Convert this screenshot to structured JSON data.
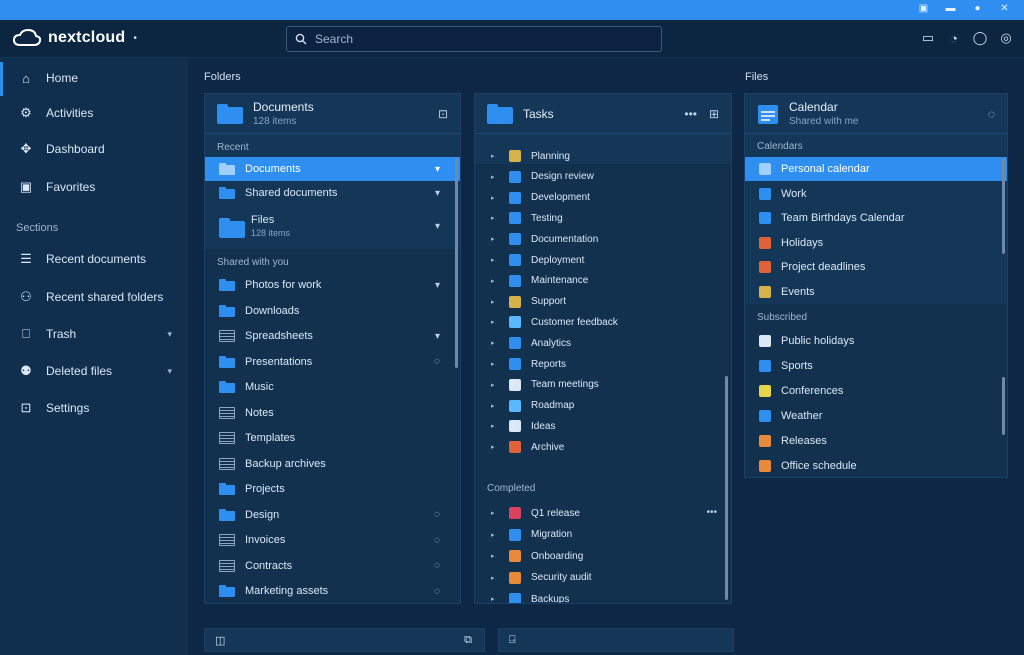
{
  "app": {
    "name": "nextcloud"
  },
  "search": {
    "placeholder": "Search"
  },
  "sidebar": {
    "items": [
      {
        "label": "Home",
        "icon": "home-icon"
      },
      {
        "label": "Activities",
        "icon": "gear-icon"
      },
      {
        "label": "Dashboard",
        "icon": "move-icon"
      },
      {
        "label": "Favorites",
        "icon": "image-icon"
      }
    ],
    "section": "Sections",
    "items2": [
      {
        "label": "Recent documents",
        "icon": "list-icon"
      },
      {
        "label": "Recent shared folders",
        "icon": "share-icon"
      },
      {
        "label": "Trash",
        "icon": "trash-icon"
      },
      {
        "label": "Deleted files",
        "icon": "people-icon"
      },
      {
        "label": "Settings",
        "icon": "folder-icon"
      }
    ]
  },
  "main": {
    "crumb_left": "Folders",
    "crumb_right": "Files",
    "panel_a": {
      "title": "Documents",
      "subtitle": "128 items",
      "section1": "Recent",
      "rows1": [
        {
          "label": "Documents",
          "trail": "▾",
          "selected": true
        },
        {
          "label": "Shared documents",
          "trail": "▾"
        },
        {
          "label": "Files",
          "sub": "128 items",
          "trail": "▾"
        }
      ],
      "section2": "Shared with you",
      "rows2": [
        {
          "label": "Photos for work",
          "type": "folder",
          "trail": "▾"
        },
        {
          "label": "Downloads",
          "type": "folder",
          "trail": ""
        },
        {
          "label": "Spreadsheets",
          "type": "doc",
          "trail": "▾"
        },
        {
          "label": "Presentations",
          "type": "folder",
          "trail": "◌"
        },
        {
          "label": "Music",
          "type": "folder",
          "trail": ""
        },
        {
          "label": "Notes",
          "type": "doc",
          "trail": ""
        },
        {
          "label": "Templates",
          "type": "doc",
          "trail": ""
        },
        {
          "label": "Backup archives",
          "type": "doc",
          "trail": ""
        },
        {
          "label": "Projects",
          "type": "folder",
          "trail": ""
        },
        {
          "label": "Design",
          "type": "folder",
          "trail": "◌"
        },
        {
          "label": "Invoices",
          "type": "doc",
          "trail": "◌"
        },
        {
          "label": "Contracts",
          "type": "doc",
          "trail": "◌"
        },
        {
          "label": "Marketing assets",
          "type": "folder",
          "trail": "◌"
        }
      ]
    },
    "panel_b": {
      "title": "Tasks",
      "tree1": [
        {
          "label": "Planning",
          "color": "#d6b24a"
        },
        {
          "label": "Design review",
          "color": "#2f8ff0"
        },
        {
          "label": "Development",
          "color": "#2f8ff0"
        },
        {
          "label": "Testing",
          "color": "#2f8ff0"
        },
        {
          "label": "Documentation",
          "color": "#2f8ff0"
        },
        {
          "label": "Deployment",
          "color": "#2f8ff0"
        },
        {
          "label": "Maintenance",
          "color": "#2f8ff0"
        },
        {
          "label": "Support",
          "color": "#d6b24a"
        },
        {
          "label": "Customer feedback",
          "color": "#5ab8ff"
        },
        {
          "label": "Analytics",
          "color": "#2f8ff0"
        },
        {
          "label": "Reports",
          "color": "#2f8ff0"
        },
        {
          "label": "Team meetings",
          "color": "#dbe8f6"
        },
        {
          "label": "Roadmap",
          "color": "#5ab8ff"
        },
        {
          "label": "Ideas",
          "color": "#dbe8f6"
        },
        {
          "label": "Archive",
          "color": "#e0623a"
        }
      ],
      "section": "Completed",
      "tree2": [
        {
          "label": "Q1 release",
          "color": "#d8425e"
        },
        {
          "label": "Migration",
          "color": "#2f8ff0"
        },
        {
          "label": "Onboarding",
          "color": "#e88a3a"
        },
        {
          "label": "Security audit",
          "color": "#e88a3a"
        },
        {
          "label": "Backups",
          "color": "#2f8ff0"
        }
      ]
    },
    "panel_c": {
      "title": "Calendar",
      "subtitle": "Shared with me",
      "section1": "Calendars",
      "rows1": [
        {
          "label": "Personal calendar",
          "color": "#9fd0ff",
          "selected": true
        },
        {
          "label": "Work",
          "color": "#2f8ff0"
        },
        {
          "label": "Team Birthdays Calendar",
          "color": "#2f8ff0"
        },
        {
          "label": "Holidays",
          "color": "#e0623a"
        },
        {
          "label": "Project deadlines",
          "color": "#e0623a"
        },
        {
          "label": "Events",
          "color": "#d6b24a"
        }
      ],
      "section2": "Subscribed",
      "rows2": [
        {
          "label": "Public holidays",
          "color": "#dbe8f6"
        },
        {
          "label": "Sports",
          "color": "#2f8ff0"
        },
        {
          "label": "Conferences",
          "color": "#e6d44a"
        },
        {
          "label": "Weather",
          "color": "#2f8ff0"
        },
        {
          "label": "Releases",
          "color": "#e88a3a"
        },
        {
          "label": "Office schedule",
          "color": "#e88a3a"
        }
      ]
    }
  }
}
